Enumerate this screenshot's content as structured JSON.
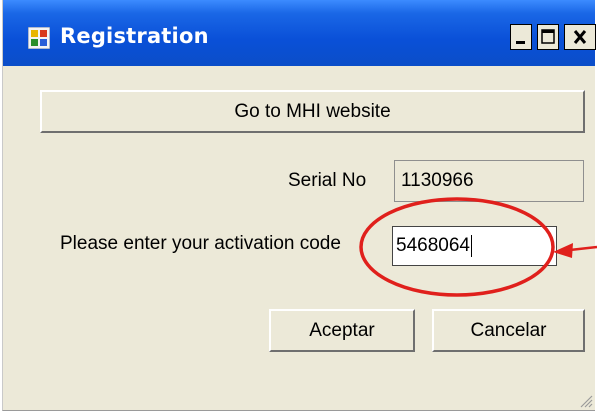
{
  "window": {
    "title": "Registration",
    "icon": "app-icon",
    "controls": [
      "minimize-icon",
      "maximize-icon",
      "close-icon"
    ]
  },
  "website_button": {
    "label": "Go to MHI website"
  },
  "serial": {
    "label": "Serial No",
    "value": "1130966"
  },
  "activation": {
    "label": "Please enter your activation code",
    "value": "5468064"
  },
  "buttons": {
    "ok": "Aceptar",
    "cancel": "Cancelar"
  },
  "annotation": {
    "color": "#e0201c",
    "shape": "ellipse-highlight-with-arrow"
  },
  "colors": {
    "titlebar": "#0a50d8",
    "dialog_bg": "#ece9d8"
  }
}
